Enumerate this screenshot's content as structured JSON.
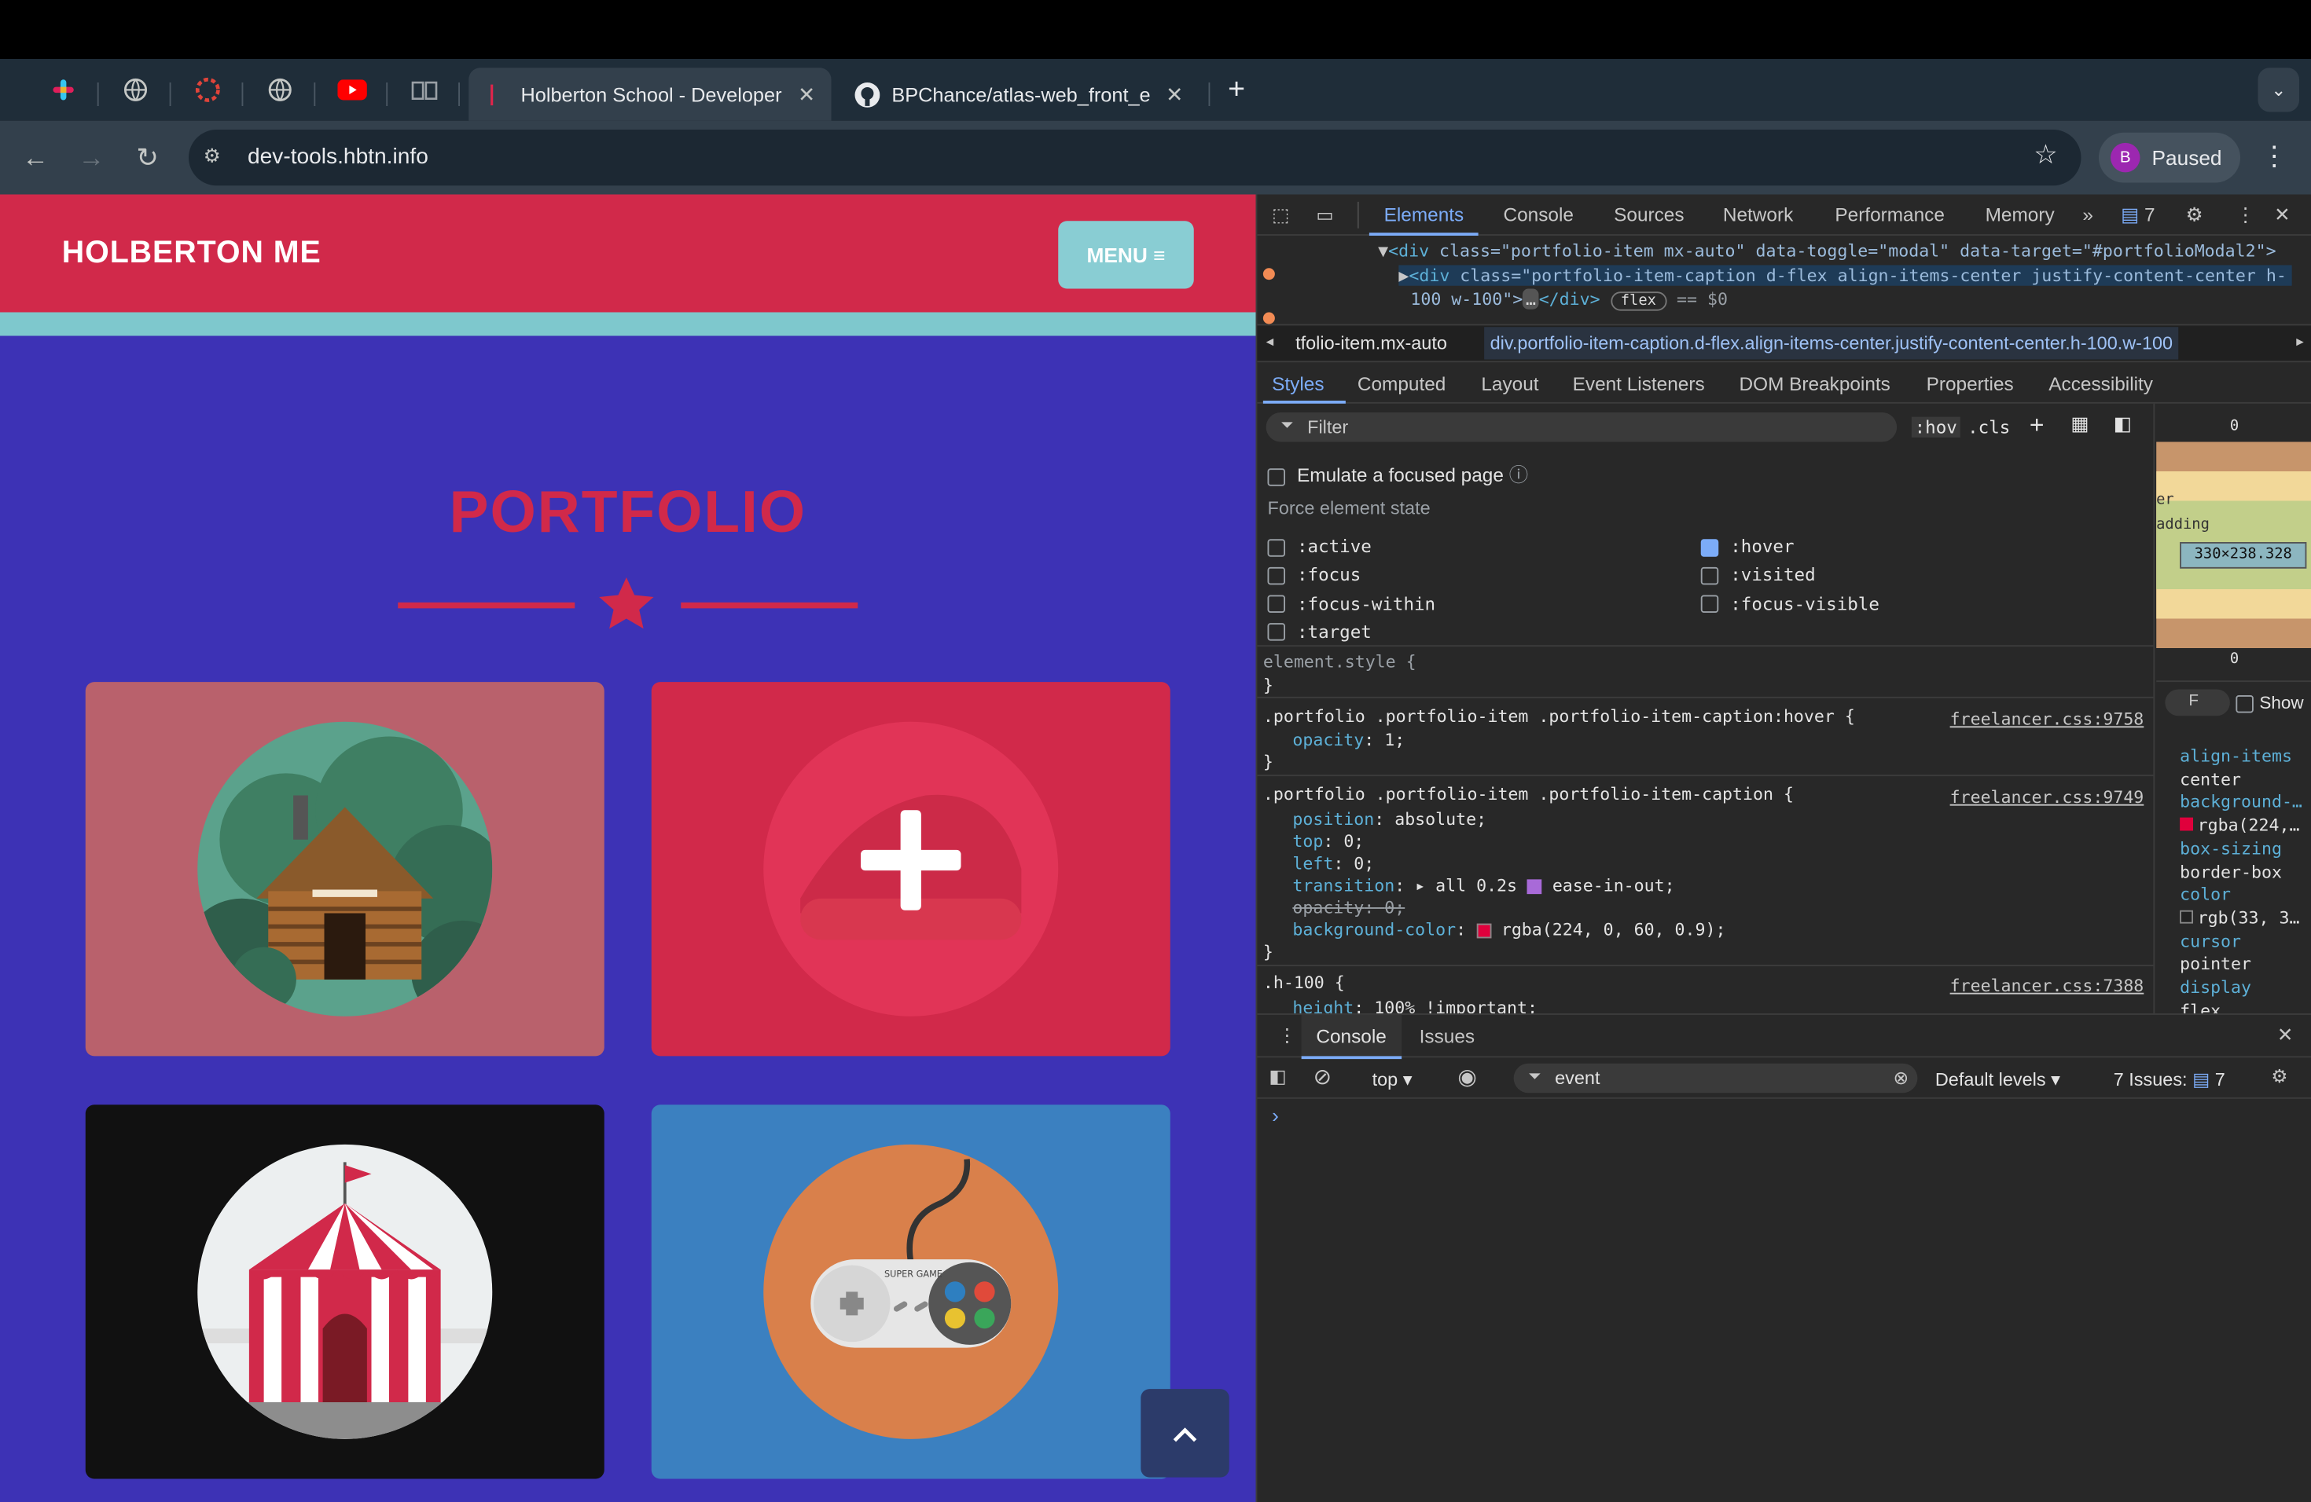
{
  "browser": {
    "tabs": [
      {
        "title": "Holberton School - Developer",
        "favicon": "holberton-icon"
      },
      {
        "title": "BPChance/atlas-web_front_end",
        "favicon": "github-icon"
      }
    ],
    "pinned_tabs": [
      "slack-icon",
      "globe-icon",
      "circle-icon",
      "globe-icon",
      "youtube-icon",
      "book-icon"
    ],
    "url": "dev-tools.hbtn.info",
    "profile_label": "Paused",
    "profile_initial": "B"
  },
  "page": {
    "brand": "HOLBERTON ME",
    "menu_label": "MENU ≡",
    "section_title": "PORTFOLIO",
    "cards": [
      {
        "image": "cabin",
        "bg": "#b9616c"
      },
      {
        "image": "cake-hover",
        "bg": "#d1294a"
      },
      {
        "image": "circus",
        "bg": "#111111"
      },
      {
        "image": "game-controller",
        "bg": "#3b80c0"
      }
    ],
    "controller_text": "SUPER GAME",
    "scroll_top_icon": "chevron-up-icon",
    "colors": {
      "primary": "#d1294a",
      "bg": "#3d32b5",
      "accent": "#89cdd3"
    }
  },
  "devtools": {
    "tabs": [
      "Elements",
      "Console",
      "Sources",
      "Network",
      "Performance",
      "Memory"
    ],
    "more": "»",
    "issues_count": "7",
    "dom_lines": [
      {
        "tag": "<div ",
        "attrs": "class=\"portfolio-item mx-auto\" data-toggle=\"modal\" data-target=\"#portfolioModal2\">"
      },
      {
        "tag": "<div ",
        "attrs": "class=\"portfolio-item-caption d-flex align-items-center justify-content-center h-"
      },
      {
        "text": "100 w-100\">"
      },
      {
        "badge": "flex"
      },
      {
        "dollar": "== $0"
      },
      {
        "ellipsis": "…"
      },
      {
        "close": "</div>"
      }
    ],
    "breadcrumbs": [
      "tfolio-item.mx-auto",
      "div.portfolio-item-caption.d-flex.align-items-center.justify-content-center.h-100.w-100"
    ],
    "styles_tabs": [
      "Styles",
      "Computed",
      "Layout",
      "Event Listeners",
      "DOM Breakpoints",
      "Properties",
      "Accessibility"
    ],
    "filter_placeholder": "Filter",
    "hov": ":hov",
    "cls": ".cls",
    "emulate_focus": "Emulate a focused page",
    "force_state_title": "Force element state",
    "states_left": [
      ":active",
      ":focus",
      ":focus-within",
      ":target"
    ],
    "states_right": [
      ":hover",
      ":visited",
      ":focus-visible"
    ],
    "hover_checked": true,
    "element_style": "element.style {",
    "close_brace": "}",
    "rule1": {
      "selector": ".portfolio .portfolio-item .portfolio-item-caption:hover {",
      "source": "freelancer.css:9758",
      "decls": [
        {
          "p": "opacity",
          "v": "1;"
        }
      ]
    },
    "rule2": {
      "selector": ".portfolio .portfolio-item .portfolio-item-caption {",
      "source": "freelancer.css:9749",
      "decls": [
        {
          "p": "position",
          "v": "absolute;"
        },
        {
          "p": "top",
          "v": "0;"
        },
        {
          "p": "left",
          "v": "0;"
        },
        {
          "p": "transition",
          "v": "▸ all 0.2s",
          "v2": "ease-in-out;"
        },
        {
          "p": "opacity",
          "v": "0;",
          "struck": true
        },
        {
          "p": "background-color",
          "v": "rgba(224, 0, 60, 0.9);"
        }
      ]
    },
    "rule3": {
      "selector": ".h-100 {",
      "source": "freelancer.css:7388",
      "decls": [
        {
          "p": "height",
          "v": "100% !important;"
        }
      ]
    },
    "boxmodel": {
      "zero_top": "0",
      "dash": "–",
      "border": "er",
      "padding": "adding",
      "content": "330×238.328",
      "zero_bottom": "0"
    },
    "computed": [
      {
        "p": "align-items",
        "v": "center"
      },
      {
        "p": "background-…",
        "v": "rgba(224,…"
      },
      {
        "p": "box-sizing",
        "v": "border-box"
      },
      {
        "p": "color",
        "v": "rgb(33, 3…"
      },
      {
        "p": "cursor",
        "v": "pointer"
      },
      {
        "p": "display",
        "v": "flex"
      }
    ],
    "computed_filter": "F",
    "show_all": "Show",
    "drawer": {
      "tabs": [
        "Console",
        "Issues"
      ],
      "context": "top",
      "filter_value": "event",
      "levels": "Default levels ▾",
      "issues": "7 Issues:",
      "issues_n": "7",
      "prompt": "›"
    }
  }
}
